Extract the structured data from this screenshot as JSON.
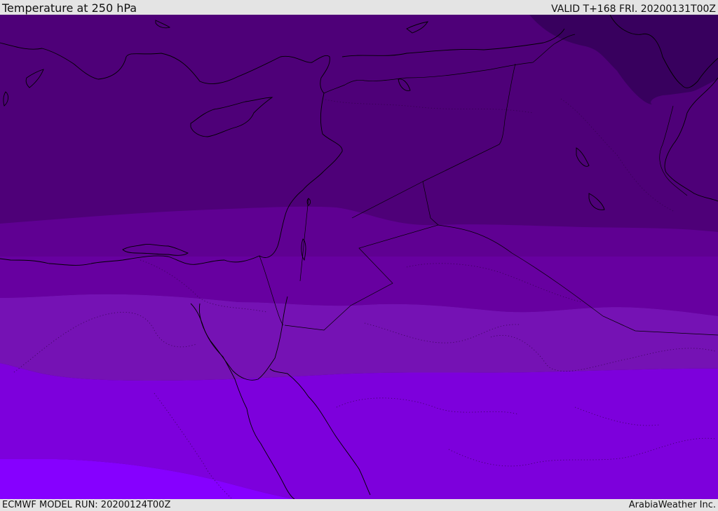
{
  "header": {
    "title": "Temperature at 250 hPa",
    "valid": "VALID T+168 FRI. 20200131T00Z"
  },
  "footer": {
    "model_run": "ECMWF MODEL RUN: 20200124T00Z",
    "credit": "ArabiaWeather Inc."
  },
  "map": {
    "field": "temperature",
    "level": "250 hPa",
    "colors": {
      "coldest_band": "#38005e",
      "band_1": "#4e0078",
      "band_2": "#5f0092",
      "band_3": "#6700a0",
      "band_4": "#7512b4",
      "band_5": "#7d00dc",
      "band_6": "#8600ff",
      "coastline": "#000000"
    }
  }
}
